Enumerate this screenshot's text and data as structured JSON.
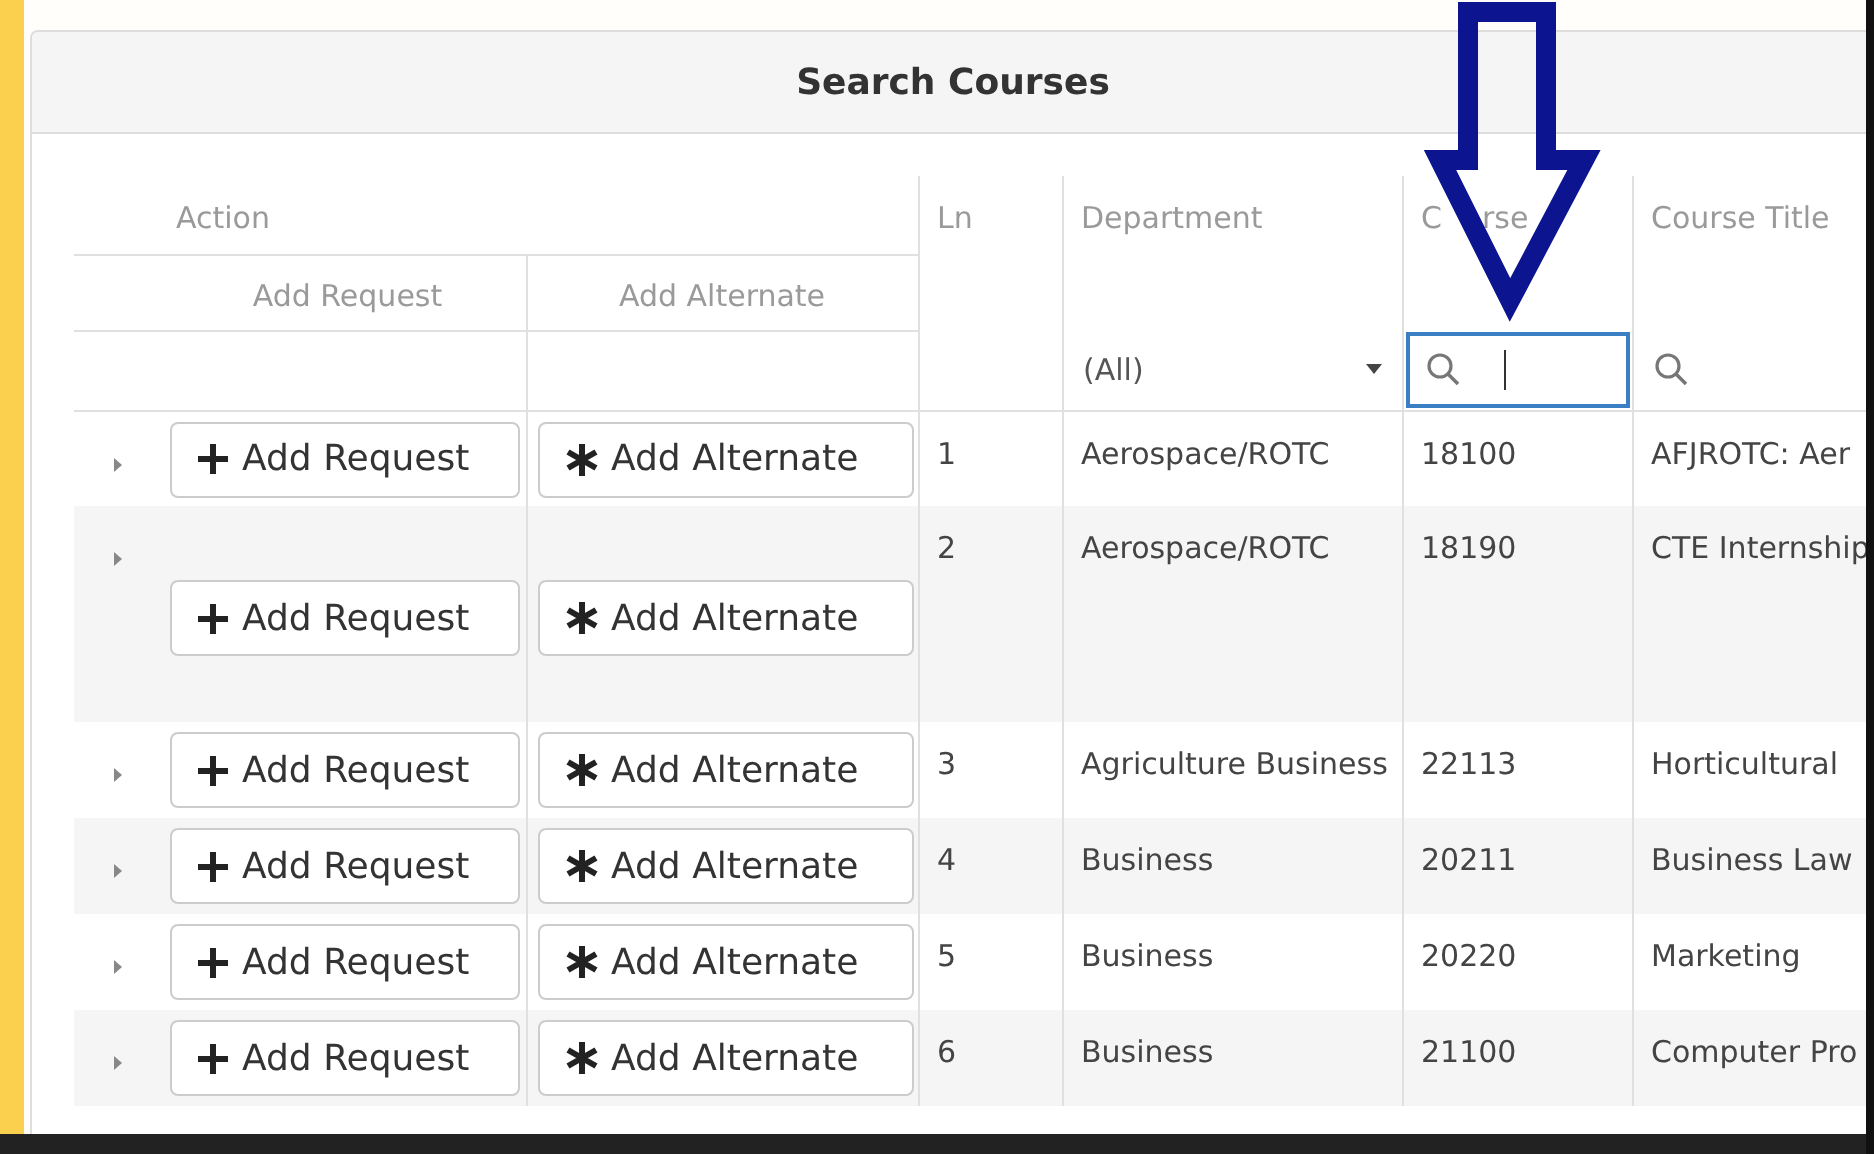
{
  "panel": {
    "title": "Search Courses"
  },
  "header": {
    "action_label": "Action",
    "subheaders": [
      "Add Request",
      "Add Alternate"
    ],
    "columns": [
      {
        "label": "Ln"
      },
      {
        "label": "Department"
      },
      {
        "fragments": [
          "C",
          "rse"
        ]
      },
      {
        "label": "Course Title"
      }
    ]
  },
  "filters": [
    {
      "kind": "select",
      "value": "(All)",
      "focused": false
    },
    {
      "kind": "search",
      "focused": true
    },
    {
      "kind": "search",
      "focused": false
    }
  ],
  "rows": [
    {
      "kind": "normal",
      "expanded": false,
      "request": "Add Request",
      "alternate": "Add Alternate",
      "ln": "1",
      "department": "Aerospace/ROTC",
      "course_id": "18100",
      "course_title": "AFJROTC: Aer"
    },
    {
      "kind": "spaced",
      "expanded": false,
      "request": "Add Request",
      "alternate": "Add Alternate",
      "ln": "2",
      "department": "Aerospace/ROTC",
      "course_id": "18190",
      "course_title": "CTE Internship"
    },
    {
      "kind": "normal",
      "expanded": false,
      "request": "Add Request",
      "alternate": "Add Alternate",
      "ln": "3",
      "department": "Agriculture Business",
      "course_id": "22113",
      "course_title": "Horticultural"
    },
    {
      "kind": "normal",
      "expanded": false,
      "request": "Add Request",
      "alternate": "Add Alternate",
      "ln": "4",
      "department": "Business",
      "course_id": "20211",
      "course_title": "Business Law"
    },
    {
      "kind": "normal",
      "expanded": false,
      "request": "Add Request",
      "alternate": "Add Alternate",
      "ln": "5",
      "department": "Business",
      "course_id": "20220",
      "course_title": "Marketing"
    },
    {
      "kind": "normal",
      "expanded": false,
      "request": "Add Request",
      "alternate": "Add Alternate",
      "ln": "6",
      "department": "Business",
      "course_id": "21100",
      "course_title": "Computer Pro"
    }
  ]
}
